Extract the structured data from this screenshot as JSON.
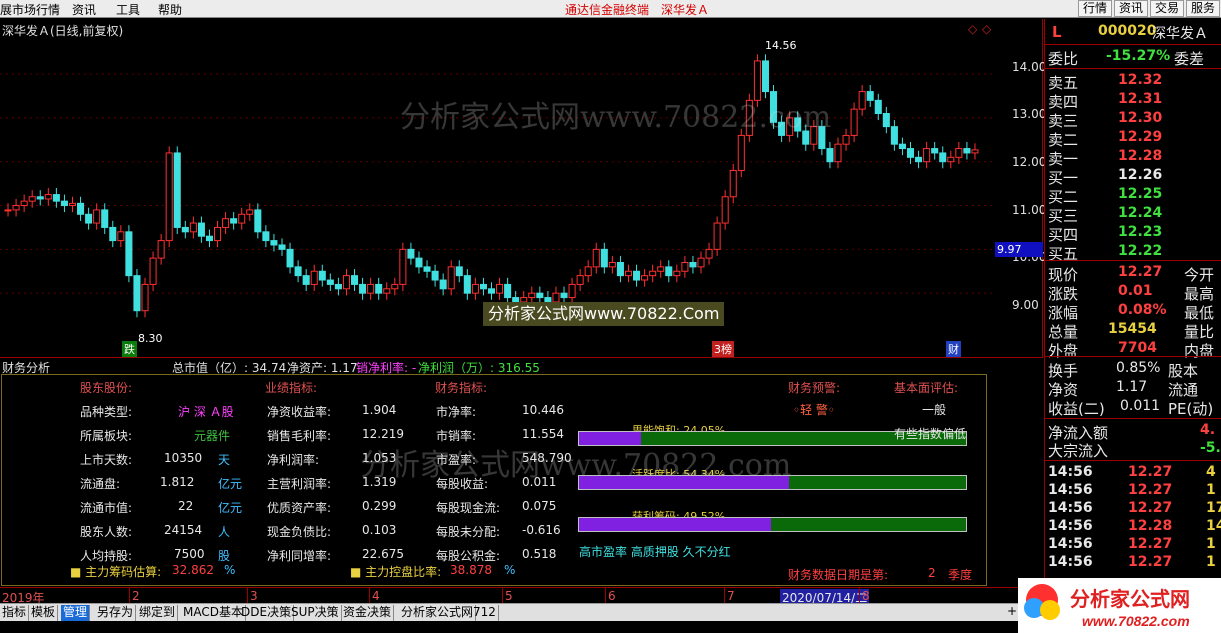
{
  "menubar": {
    "items": [
      "展市场行情",
      "资讯",
      "工具",
      "帮助"
    ],
    "title": "通达信金融终端　深华发Ａ",
    "right_buttons": [
      "行情",
      "资讯",
      "交易",
      "服务"
    ]
  },
  "chart": {
    "title": "深华发Ａ(日线,前复权)",
    "high_label": "14.56",
    "low_label": "8.30",
    "current_price": "9.97",
    "yticks": [
      "14.00",
      "13.00",
      "12.00",
      "11.00",
      "10.00",
      "9.00"
    ],
    "marks": [
      "跌",
      "3榜",
      "财"
    ]
  },
  "watermark": {
    "text": "分析家公式网www.70822.com",
    "banner": "分析家公式网www.70822.Com"
  },
  "fin_header": {
    "section": "财务分析",
    "total_cap": "总市值（亿）: 34.74",
    "net_assets": "净资产: 1.17",
    "net_margin": "销净利率: -",
    "net_profit": "净利润（万）: 316.55"
  },
  "fin": {
    "col_headers": [
      "股东股份:",
      "业绩指标:",
      "财务指标:",
      "财务预警:",
      "基本面评估:"
    ],
    "left": [
      {
        "l": "品种类型:",
        "v": "沪 深 Ａ股",
        "u": ""
      },
      {
        "l": "所属板块:",
        "v": "元器件",
        "u": ""
      },
      {
        "l": "上市天数:",
        "v": "10350",
        "u": "天"
      },
      {
        "l": "流通盘:",
        "v": "1.812",
        "u": "亿元"
      },
      {
        "l": "流通市值:",
        "v": "22",
        "u": "亿元"
      },
      {
        "l": "股东人数:",
        "v": "24154",
        "u": "人"
      },
      {
        "l": "人均持股:",
        "v": "7500",
        "u": "股"
      }
    ],
    "mid": [
      {
        "l": "净资收益率:",
        "v": "1.904"
      },
      {
        "l": "销售毛利率:",
        "v": "12.219"
      },
      {
        "l": "净利润率:",
        "v": "1.053"
      },
      {
        "l": "主营利润率:",
        "v": "1.319"
      },
      {
        "l": "优质资产率:",
        "v": "0.299"
      },
      {
        "l": "现金负债比:",
        "v": "0.103"
      },
      {
        "l": "净利同增率:",
        "v": "22.675"
      }
    ],
    "right": [
      {
        "l": "市净率:",
        "v": "10.446"
      },
      {
        "l": "市销率:",
        "v": "11.554"
      },
      {
        "l": "市盈率:",
        "v": "548.790"
      },
      {
        "l": "每股收益:",
        "v": "0.011"
      },
      {
        "l": "每股现金流:",
        "v": "0.075"
      },
      {
        "l": "每股未分配:",
        "v": "-0.616"
      },
      {
        "l": "每股公积金:",
        "v": "0.518"
      }
    ],
    "warning": "◦轻 警◦",
    "evaluation": "一般",
    "eval_note": "有些指数偏低",
    "bars": [
      {
        "label": "思能饱和: 24.05%",
        "pct": 0.1605
      },
      {
        "label": "活跃度比: 54.34%",
        "pct": 0.5434
      },
      {
        "label": "获利筹码: 49.52%",
        "pct": 0.4952
      }
    ],
    "tags": "高市盈率 高质押股 久不分红",
    "chip_est_label": "主力筹码估算:",
    "chip_est_val": "32.862",
    "chip_est_unit": "%",
    "control_label": "主力控盘比率:",
    "control_val": "38.878",
    "control_unit": "%",
    "report_label": "财务数据日期是第:",
    "report_num": "2",
    "report_unit": "季度"
  },
  "timeaxis": {
    "labels": [
      "2019年",
      "2",
      "3",
      "4",
      "5",
      "6",
      "7",
      "2020/07/14/二",
      "8"
    ]
  },
  "bottom_tabs": [
    "指标",
    "模板",
    "管理",
    "另存为",
    "绑定到",
    "MACD基本",
    "DDE决策",
    "SUP决策",
    "资金决策",
    "分析家公式网",
    "712"
  ],
  "quote": {
    "code": "000020",
    "name": "深华发Ａ",
    "flag": "L",
    "weibi_label": "委比",
    "weibi": "-15.27%",
    "weicha_label": "委差",
    "asks": [
      {
        "l": "卖五",
        "p": "12.32"
      },
      {
        "l": "卖四",
        "p": "12.31"
      },
      {
        "l": "卖三",
        "p": "12.30"
      },
      {
        "l": "卖二",
        "p": "12.29"
      },
      {
        "l": "卖一",
        "p": "12.28"
      }
    ],
    "bids": [
      {
        "l": "买一",
        "p": "12.26"
      },
      {
        "l": "买二",
        "p": "12.25"
      },
      {
        "l": "买三",
        "p": "12.24"
      },
      {
        "l": "买四",
        "p": "12.23"
      },
      {
        "l": "买五",
        "p": "12.22"
      }
    ],
    "stats": [
      {
        "l": "现价",
        "v": "12.27",
        "r": "今开"
      },
      {
        "l": "涨跌",
        "v": "0.01",
        "r": "最高"
      },
      {
        "l": "涨幅",
        "v": "0.08%",
        "r": "最低"
      },
      {
        "l": "总量",
        "v": "15454",
        "r": "量比"
      },
      {
        "l": "外盘",
        "v": "7704",
        "r": "内盘"
      }
    ],
    "stats2": [
      {
        "l": "换手",
        "v": "0.85%",
        "r": "股本"
      },
      {
        "l": "净资",
        "v": "1.17",
        "r": "流通"
      },
      {
        "l": "收益(二)",
        "v": "0.011",
        "r": "PE(动)"
      }
    ],
    "flow": [
      {
        "l": "净流入额",
        "v": "4."
      },
      {
        "l": "大宗流入",
        "v": "-5."
      }
    ],
    "ticks": [
      {
        "t": "14:56",
        "p": "12.27",
        "v": "4"
      },
      {
        "t": "14:56",
        "p": "12.27",
        "v": "1"
      },
      {
        "t": "14:56",
        "p": "12.27",
        "v": "17"
      },
      {
        "t": "14:56",
        "p": "12.28",
        "v": "14"
      },
      {
        "t": "14:56",
        "p": "12.27",
        "v": "1"
      },
      {
        "t": "14:56",
        "p": "12.27",
        "v": "1"
      }
    ]
  },
  "logo": {
    "text": "分析家公式网",
    "url": "www.70822.com"
  },
  "chart_data": {
    "type": "candlestick",
    "ylim": [
      8.0,
      14.8
    ],
    "high": 14.56,
    "low": 8.3,
    "last": 12.27
  }
}
